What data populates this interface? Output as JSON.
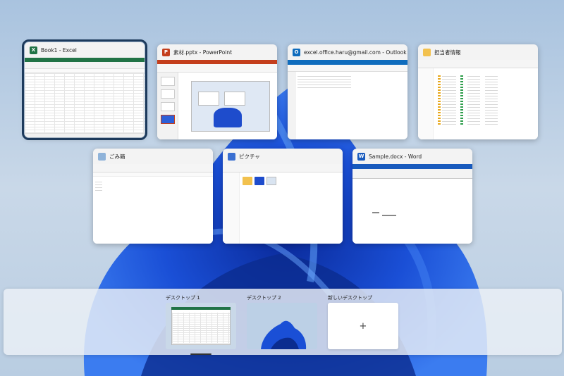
{
  "colors": {
    "excel": "#217346",
    "powerpoint": "#c43e1c",
    "outlook": "#0f6cbd",
    "word": "#185abd",
    "folder": "#f2c14e",
    "selected_outline": "#1d3a5c"
  },
  "windows": [
    {
      "title": "Book1 - Excel",
      "icon": "excel-icon",
      "icon_letter": "X"
    },
    {
      "title": "素材.pptx - PowerPoint",
      "icon": "powerpoint-icon",
      "icon_letter": "P"
    },
    {
      "title": "excel.office.haru@gmail.com - Outlook",
      "icon": "outlook-icon",
      "icon_letter": "O"
    },
    {
      "title": "担当者情報",
      "icon": "folder-icon"
    },
    {
      "title": "ごみ箱",
      "icon": "recycle-bin-icon"
    },
    {
      "title": "ピクチャ",
      "icon": "pictures-folder-icon"
    },
    {
      "title": "Sample.docx - Word",
      "icon": "word-icon",
      "icon_letter": "W"
    }
  ],
  "desktops": {
    "items": [
      {
        "label": "デスクトップ 1"
      },
      {
        "label": "デスクトップ 2"
      }
    ],
    "new_label": "新しいデスクトップ",
    "add_glyph": "+"
  }
}
